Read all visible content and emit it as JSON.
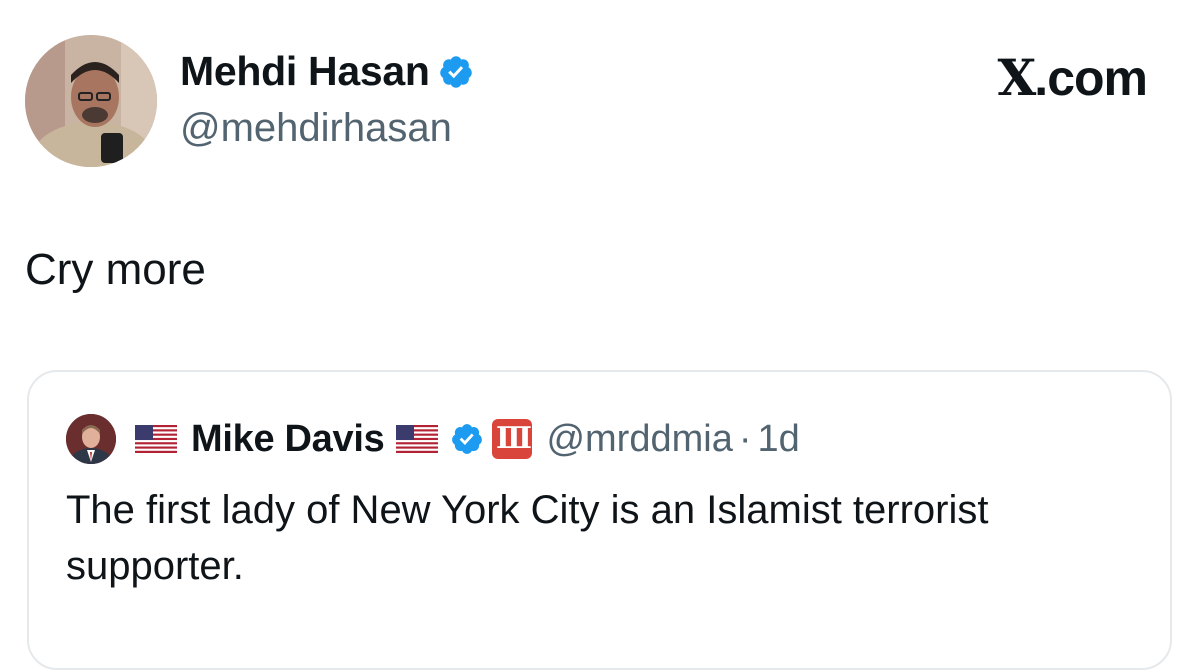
{
  "post": {
    "author_name": "Mehdi Hasan",
    "author_handle": "@mehdirhasan",
    "brand": "X.com",
    "brand_x": "X",
    "brand_suffix": ".com",
    "text": "Cry more",
    "verified_color": "#1d9bf0",
    "avatar_icon": "person-with-microphone-photo"
  },
  "quoted_post": {
    "author_name": "Mike Davis",
    "author_handle": "@mrddmia",
    "separator": "·",
    "time_ago": "1d",
    "flag_icon": "us-flag-icon",
    "org_badge_text": "III",
    "org_badge_color": "#d9453a",
    "text": "The first lady of New York City is an Islamist terrorist supporter."
  }
}
